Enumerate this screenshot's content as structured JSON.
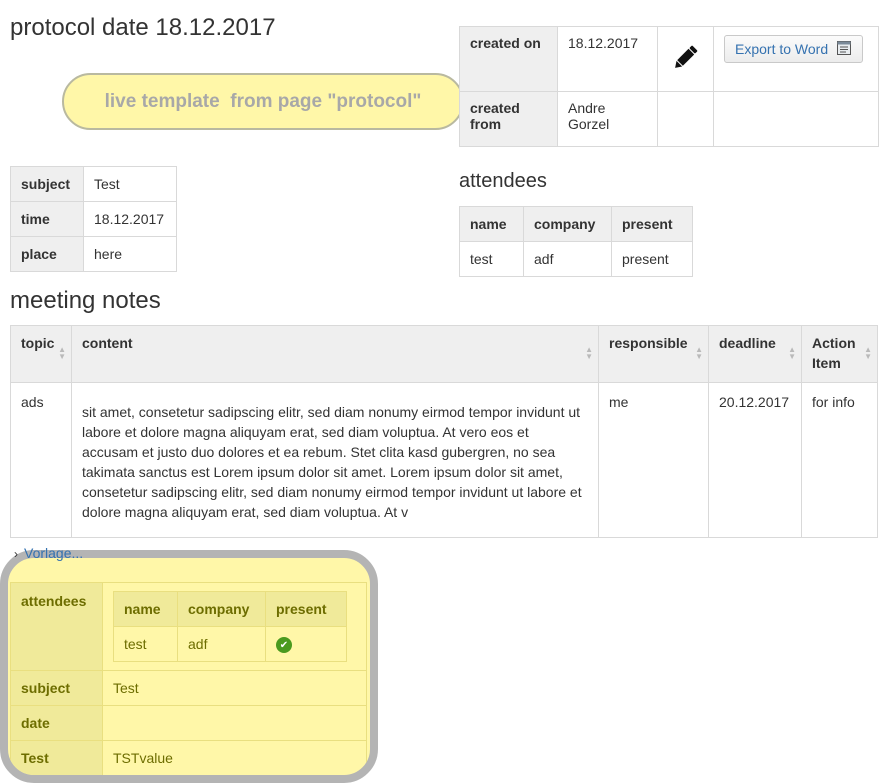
{
  "page": {
    "title": "protocol date 18.12.2017"
  },
  "live_template": {
    "text": "live template  from page \"protocol\""
  },
  "meta": {
    "created_on_label": "created on",
    "created_on_value": "18.12.2017",
    "created_from_label": "created from",
    "created_from_value_line1": "Andre",
    "created_from_value_line2": "Gorzel",
    "export_label": "Export to Word",
    "icons": {
      "edit": "pencil-icon",
      "export": "word-document-icon"
    }
  },
  "info": {
    "rows": [
      {
        "label": "subject",
        "value": "Test"
      },
      {
        "label": "time",
        "value": "18.12.2017"
      },
      {
        "label": "place",
        "value": "here"
      }
    ]
  },
  "attendees": {
    "heading": "attendees",
    "columns": [
      "name",
      "company",
      "present"
    ],
    "rows": [
      [
        "test",
        "adf",
        "present"
      ]
    ]
  },
  "meeting_notes": {
    "heading": "meeting notes",
    "columns": [
      "topic",
      "content",
      "responsible",
      "deadline",
      "Action Item"
    ],
    "rows": [
      [
        "ads",
        " sit amet, consetetur sadipscing elitr, sed diam nonumy eirmod tempor invidunt ut labore et dolore magna aliquyam erat, sed diam voluptua. At vero eos et accusam et justo duo dolores et ea rebum. Stet clita kasd gubergren, no sea takimata sanctus est Lorem ipsum dolor sit amet. Lorem ipsum dolor sit amet, consetetur sadipscing elitr, sed diam nonumy eirmod tempor invidunt ut labore et dolore magna aliquyam erat, sed diam voluptua. At v",
        "me",
        "20.12.2017",
        "for info"
      ]
    ]
  },
  "vorlage": {
    "label": "Vorlage..."
  },
  "template_preview": {
    "attendees_label": "attendees",
    "columns": [
      "name",
      "company",
      "present"
    ],
    "row": {
      "name": "test",
      "company": "adf",
      "present_icon": "check-circle-icon"
    },
    "rows": [
      {
        "label": "subject",
        "value": "Test"
      },
      {
        "label": "date",
        "value": ""
      },
      {
        "label": "Test",
        "value": "TSTvalue"
      }
    ],
    "colors": {
      "background": "#fff7a8",
      "border": "#b4b4b4",
      "check": "#4a9a1e"
    }
  }
}
